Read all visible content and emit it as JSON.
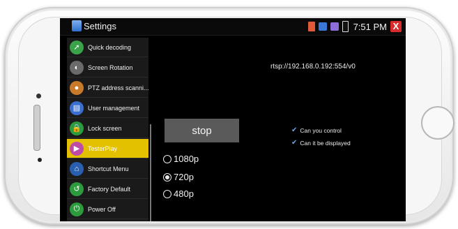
{
  "status_bar": {
    "title": "Settings",
    "time": "7:51 PM",
    "close_glyph": "X",
    "icons": [
      "sd-card-icon",
      "network-icon",
      "usb-icon",
      "battery-icon"
    ]
  },
  "menu": {
    "items": [
      {
        "label": "Quick decoding",
        "icon": "rocket-icon",
        "color": "#3aa34a",
        "glyph": "➚"
      },
      {
        "label": "Screen Rotation",
        "icon": "rotation-icon",
        "color": "#6a6a6a",
        "glyph": "◐"
      },
      {
        "label": "PTZ address scanni...",
        "icon": "ptz-icon",
        "color": "#c77a2a",
        "glyph": "●"
      },
      {
        "label": "User management",
        "icon": "user-icon",
        "color": "#3a6fd0",
        "glyph": "▤"
      },
      {
        "label": "Lock screen",
        "icon": "lock-icon",
        "color": "#2e9a3e",
        "glyph": "🔒"
      },
      {
        "label": "TesterPlay",
        "icon": "play-icon",
        "color": "#c04aa8",
        "glyph": "▶"
      },
      {
        "label": "Shortcut Menu",
        "icon": "shortcut-icon",
        "color": "#2a5fb0",
        "glyph": "⌂"
      },
      {
        "label": "Factory Default",
        "icon": "reset-icon",
        "color": "#2e9a3e",
        "glyph": "↺"
      },
      {
        "label": "Power Off",
        "icon": "power-icon",
        "color": "#2e9a3e",
        "glyph": "⏻"
      }
    ],
    "selected": "TesterPlay"
  },
  "content": {
    "url": "rtsp://192.168.0.192:554/v0",
    "stop_label": "stop",
    "checks": [
      {
        "label": "Can you control",
        "checked": true
      },
      {
        "label": "Can it be displayed",
        "checked": true
      }
    ],
    "resolutions": [
      {
        "label": "1080p",
        "selected": false
      },
      {
        "label": "720p",
        "selected": true
      },
      {
        "label": "480p",
        "selected": false
      }
    ]
  }
}
